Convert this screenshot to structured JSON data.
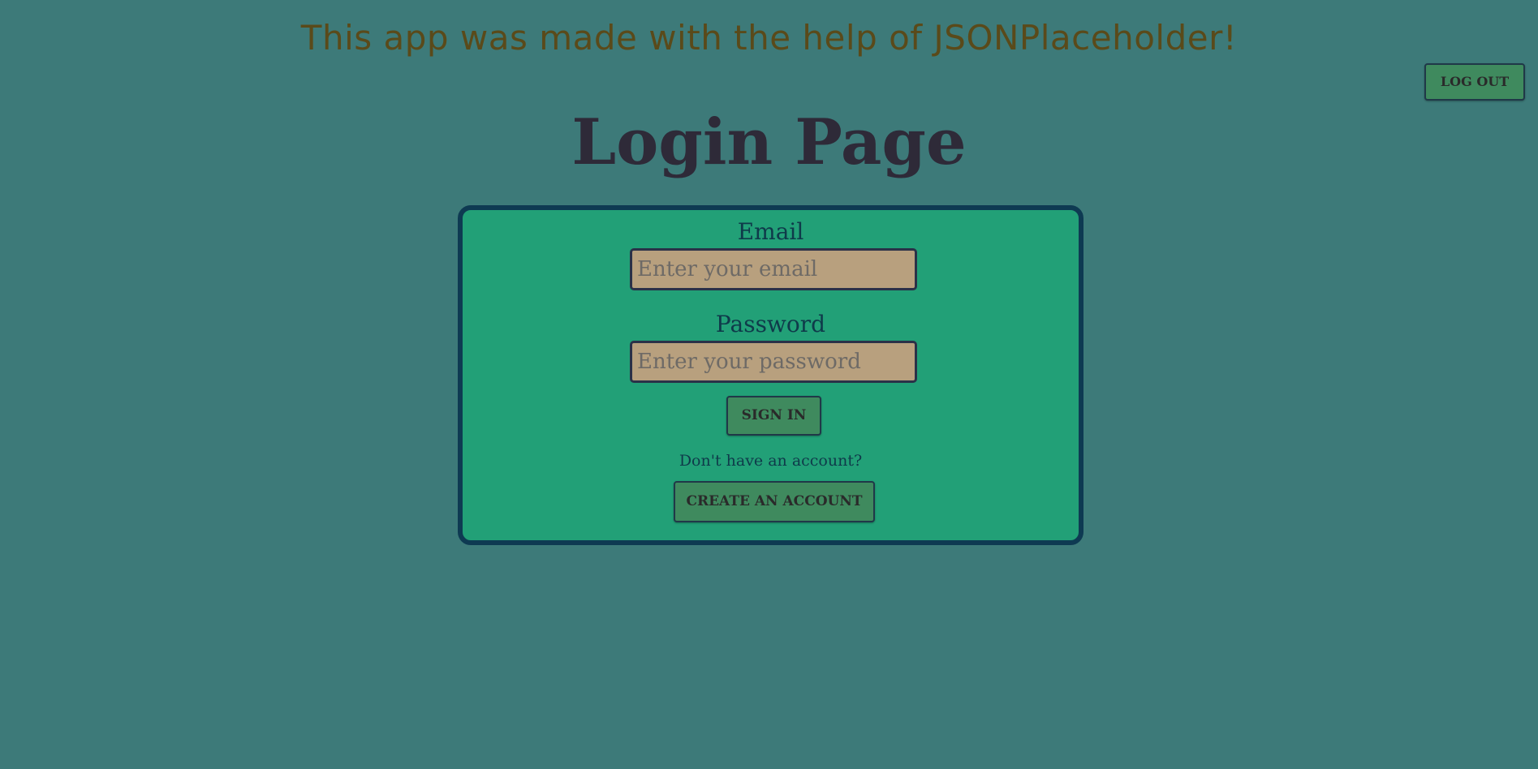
{
  "banner": {
    "text": "This app was made with the help of JSONPlaceholder!"
  },
  "header": {
    "logout_label": "LOG OUT"
  },
  "page": {
    "title": "Login Page"
  },
  "form": {
    "email_label": "Email",
    "email_placeholder": "Enter your email",
    "email_value": "",
    "password_label": "Password",
    "password_placeholder": "Enter your password",
    "password_value": "",
    "signin_label": "SIGN IN",
    "no_account_text": "Don't have an account?",
    "create_account_label": "CREATE AN ACCOUNT"
  },
  "colors": {
    "background": "#3d7a79",
    "card_background": "#22a077",
    "card_border": "#0e3a52",
    "button_background": "#3f8a5e",
    "input_background": "#b8a07e",
    "banner_text": "#5a4a1a",
    "title_text": "#2e2a38"
  }
}
